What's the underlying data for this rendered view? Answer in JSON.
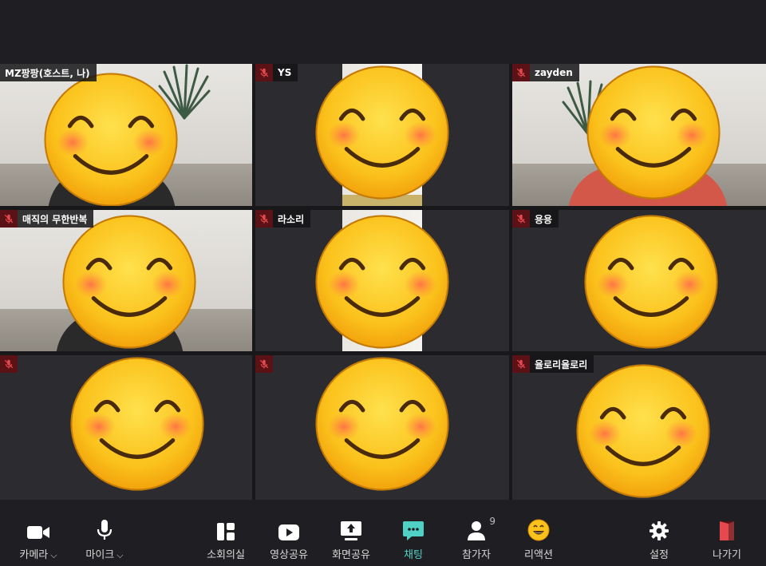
{
  "participants": [
    {
      "name": "MZ팡팡(호스트, 나)",
      "muted": false
    },
    {
      "name": "YS",
      "muted": true
    },
    {
      "name": "zayden",
      "muted": true
    },
    {
      "name": "매직의 무한반복",
      "muted": true
    },
    {
      "name": "라소리",
      "muted": true
    },
    {
      "name": "용용",
      "muted": true
    },
    {
      "name": "",
      "muted": true
    },
    {
      "name": "",
      "muted": true
    },
    {
      "name": "율로리율로리",
      "muted": true
    }
  ],
  "toolbar": {
    "camera": "카메라",
    "mic": "마이크",
    "breakout": "소회의실",
    "video_share": "영상공유",
    "screen_share": "화면공유",
    "chat": "채팅",
    "participants": "참가자",
    "participant_count": "9",
    "reaction": "리액션",
    "settings": "설정",
    "leave": "나가기"
  },
  "colors": {
    "chat_active": "#4fd1c5",
    "leave": "#e5484d",
    "muted": "#5a1216"
  },
  "icons": [
    "camera-icon",
    "microphone-icon",
    "layout-icon",
    "video-play-icon",
    "screen-share-icon",
    "chat-icon",
    "person-icon",
    "smiley-icon",
    "gear-icon",
    "door-icon",
    "mic-muted-icon",
    "smiling-face-icon"
  ]
}
